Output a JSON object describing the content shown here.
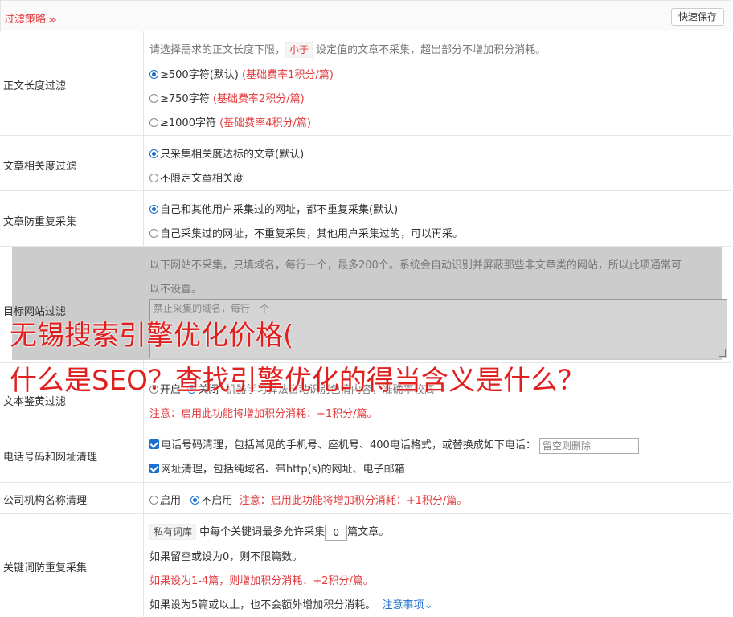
{
  "header": {
    "title": "过滤策略",
    "save_label": "快速保存"
  },
  "length_filter": {
    "label": "正文长度过滤",
    "desc_pre": "请选择需求的正文长度下限，",
    "desc_tag": "小于",
    "desc_post": "设定值的文章不采集，超出部分不增加积分消耗。",
    "options": [
      {
        "text": "≥500字符(默认)",
        "note": "(基础费率1积分/篇)"
      },
      {
        "text": "≥750字符",
        "note": "(基础费率2积分/篇)"
      },
      {
        "text": "≥1000字符",
        "note": "(基础费率4积分/篇)"
      }
    ]
  },
  "relevance_filter": {
    "label": "文章相关度过滤",
    "options": [
      "只采集相关度达标的文章(默认)",
      "不限定文章相关度"
    ]
  },
  "dup_filter": {
    "label": "文章防重复采集",
    "options": [
      "自己和其他用户采集过的网址，都不重复采集(默认)",
      "自己采集过的网址，不重复采集，其他用户采集过的，可以再采。"
    ]
  },
  "site_filter": {
    "label": "目标网站过滤",
    "desc_line1": "以下网站不采集，只填域名，每行一个，最多200个。系统会自动识别并屏蔽那些非文章类的网站，所以此项通常可",
    "desc_line2": "以不设置。",
    "placeholder": "禁止采集的域名，每行一个"
  },
  "overlay_text": {
    "line1": "无锡搜索引擎优化价格(",
    "line2": "什么是SEO？查找引擎优化的得当含义是什么？"
  },
  "porn_filter": {
    "label": "文本鉴黄过滤",
    "opt_on": "开启",
    "opt_off": "关闭",
    "desc": "机器学习算法自动识别色情内容，准确率较高",
    "warn": "注意：启用此功能将增加积分消耗：+1积分/篇。"
  },
  "phone_filter": {
    "label": "电话号码和网址清理",
    "phone_text": "电话号码清理，包括常见的手机号、座机号、400电话格式，或替换成如下电话：",
    "phone_placeholder": "留空则删除",
    "url_text": "网址清理，包括纯域名、带http(s)的网址、电子邮箱"
  },
  "company_filter": {
    "label": "公司机构名称清理",
    "opt_on": "启用",
    "opt_off": "不启用",
    "warn": "注意：启用此功能将增加积分消耗：+1积分/篇。"
  },
  "keyword_filter": {
    "label": "关键词防重复采集",
    "tag": "私有词库",
    "line1_pre": "中每个关键词最多允许采集",
    "count": "0",
    "line1_post": "篇文章。",
    "line2": "如果留空或设为0，则不限篇数。",
    "line3": "如果设为1-4篇，则增加积分消耗：+2积分/篇。",
    "line4": "如果设为5篇或以上，也不会额外增加积分消耗。",
    "link": "注意事项"
  }
}
